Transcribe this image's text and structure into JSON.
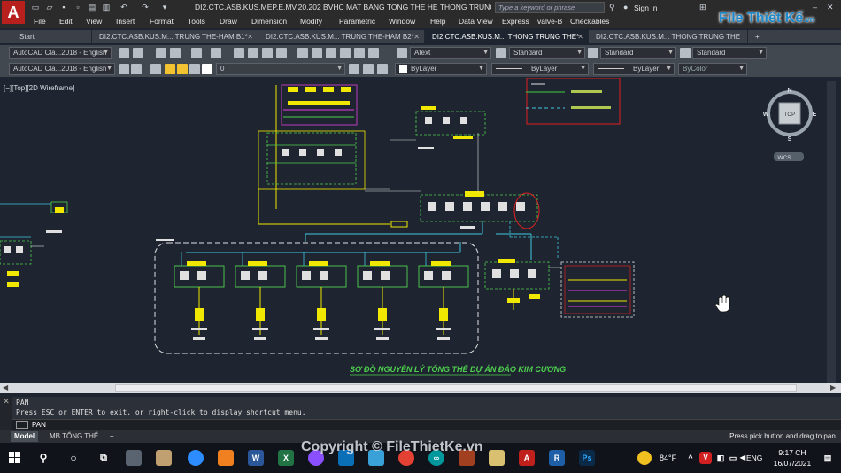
{
  "titlebar": {
    "app_logo": "A",
    "title": "DI2.CTC.ASB.KUS.MEP.E.MV.20.202 BVHC MAT BANG TONG THE HE THONG TRUNG ...",
    "search_placeholder": "Type a keyword or phrase",
    "sign_in": "Sign In"
  },
  "menu": [
    "File",
    "Edit",
    "View",
    "Insert",
    "Format",
    "Tools",
    "Draw",
    "Dimension",
    "Modify",
    "Parametric",
    "Window",
    "Help",
    "Data View",
    "Express",
    "valve-B",
    "Checkables"
  ],
  "file_tabs": [
    {
      "label": "Start"
    },
    {
      "label": "DI2.CTC.ASB.KUS.M... TRUNG THE-HAM B1*"
    },
    {
      "label": "DI2.CTC.ASB.KUS.M... TRUNG THE-HAM B2*"
    },
    {
      "label": "DI2.CTC.ASB.KUS.M... THONG TRUNG THE*"
    },
    {
      "label": "DI2.CTC.ASB.KUS.M... THONG TRUNG THE"
    }
  ],
  "toolbar": {
    "workspace": "AutoCAD Cla...2018 - English",
    "text_style": "Atext",
    "dim_style": "Standard",
    "table_style": "Standard",
    "mleader_style": "Standard",
    "layer": "0",
    "color": "ByLayer",
    "linetype": "ByLayer",
    "lineweight": "ByLayer",
    "plotstyle": "ByColor"
  },
  "viewport": {
    "label": "[−][Top][2D Wireframe]",
    "viewcube_face": "TOP",
    "compass": {
      "n": "N",
      "s": "S",
      "e": "E",
      "w": "W"
    },
    "wcs": "WCS"
  },
  "drawing": {
    "caption": "SƠ ĐỒ NGUYÊN LÝ TỔNG THỂ DỰ ÁN ĐẢO KIM CƯƠNG"
  },
  "command": {
    "history_1": "PAN",
    "history_2": "Press ESC or ENTER to exit, or right-click to display shortcut menu.",
    "input": "PAN"
  },
  "layout_tabs": [
    "Model",
    "MB TỔNG THỂ"
  ],
  "status_message": "Press pick button and drag to pan.",
  "taskbar": {
    "temperature": "84°F",
    "language": "ENG",
    "time": "9:17 CH",
    "date": "16/07/2021"
  },
  "watermark": {
    "brand": "File Thiết Kế",
    "brand_suffix": ".vn",
    "copyright": "Copyright © FileThietKe.vn"
  },
  "colors": {
    "canvas": "#1e2530",
    "autocad_red": "#b8201e",
    "cyan_line": "#3fc6e0",
    "green_line": "#4fd04f",
    "yellow": "#f0e800",
    "magenta": "#e040e0"
  }
}
